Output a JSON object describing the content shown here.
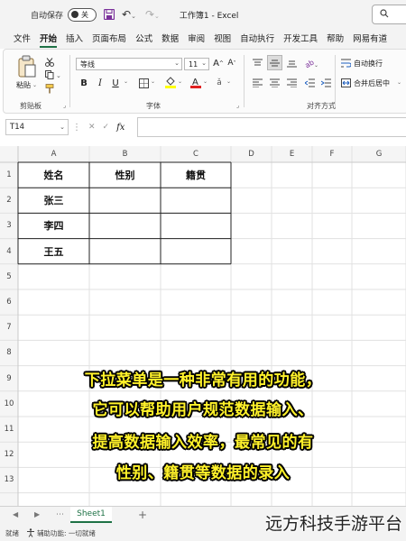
{
  "titlebar": {
    "autosave_label": "自动保存",
    "autosave_state": "关",
    "doc_title": "工作簿1 - Excel"
  },
  "menu": {
    "tabs": [
      {
        "label": "文件",
        "active": false
      },
      {
        "label": "开始",
        "active": true
      },
      {
        "label": "插入",
        "active": false
      },
      {
        "label": "页面布局",
        "active": false
      },
      {
        "label": "公式",
        "active": false
      },
      {
        "label": "数据",
        "active": false
      },
      {
        "label": "审阅",
        "active": false
      },
      {
        "label": "视图",
        "active": false
      },
      {
        "label": "自动执行",
        "active": false
      },
      {
        "label": "开发工具",
        "active": false
      },
      {
        "label": "帮助",
        "active": false
      },
      {
        "label": "网易有道",
        "active": false
      }
    ]
  },
  "ribbon": {
    "clipboard": {
      "paste_label": "粘贴",
      "group_label": "剪贴板"
    },
    "font": {
      "font_name": "等线",
      "font_size": "11",
      "group_label": "字体",
      "bold": "B",
      "italic": "I",
      "underline": "U"
    },
    "alignment": {
      "wrap_label": "自动换行",
      "merge_label": "合并后居中",
      "group_label": "对齐方式"
    }
  },
  "formula_bar": {
    "name_box": "T14",
    "fx": "fx"
  },
  "grid": {
    "columns": [
      "A",
      "B",
      "C",
      "D",
      "E",
      "F",
      "G"
    ],
    "rows": [
      "1",
      "2",
      "3",
      "4",
      "5",
      "6",
      "7",
      "8",
      "9",
      "10",
      "11",
      "12",
      "13"
    ],
    "cells": {
      "A1": "姓名",
      "B1": "性别",
      "C1": "籍贯",
      "A2": "张三",
      "A3": "李四",
      "A4": "王五"
    }
  },
  "caption": {
    "lines": [
      "下拉菜单是一种非常有用的功能，",
      "它可以帮助用户规范数据输入、",
      "提高数据输入效率，最常见的有",
      "性别、籍贯等数据的录入"
    ]
  },
  "sheets": {
    "tabs": [
      "Sheet1"
    ]
  },
  "status": {
    "ready": "就绪",
    "accessibility": "辅助功能: 一切就绪"
  },
  "watermark": "远方科技手游平台",
  "colors": {
    "accent": "#1e7145",
    "caption": "#fff22a"
  }
}
